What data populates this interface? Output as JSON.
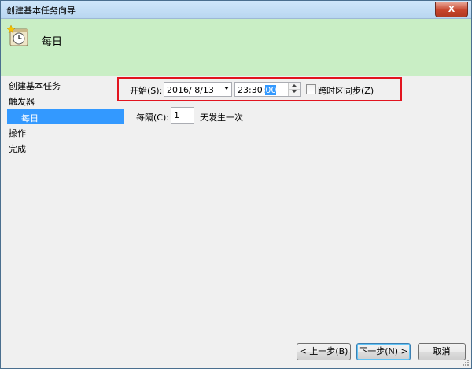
{
  "window": {
    "title": "创建基本任务向导",
    "close_label": "X"
  },
  "header": {
    "title": "每日"
  },
  "sidebar": {
    "items": [
      {
        "label": "创建基本任务"
      },
      {
        "label": "触发器"
      },
      {
        "label": "每日"
      },
      {
        "label": "操作"
      },
      {
        "label": "完成"
      }
    ],
    "selected_index": 2
  },
  "form": {
    "start_label": "开始(S):",
    "date_value": "2016/  8/13",
    "time_hm": "23:30:",
    "time_sec": "00",
    "sync_label": "跨时区同步(Z)",
    "sync_checked": false,
    "interval_label": "每隔(C):",
    "interval_value": "1",
    "interval_suffix": "天发生一次"
  },
  "buttons": {
    "back": "< 上一步(B)",
    "next": "下一步(N) >",
    "cancel": "取消"
  },
  "colors": {
    "header_bg": "#c9eec5",
    "selection": "#3399ff",
    "highlight_box": "#e2141f"
  }
}
